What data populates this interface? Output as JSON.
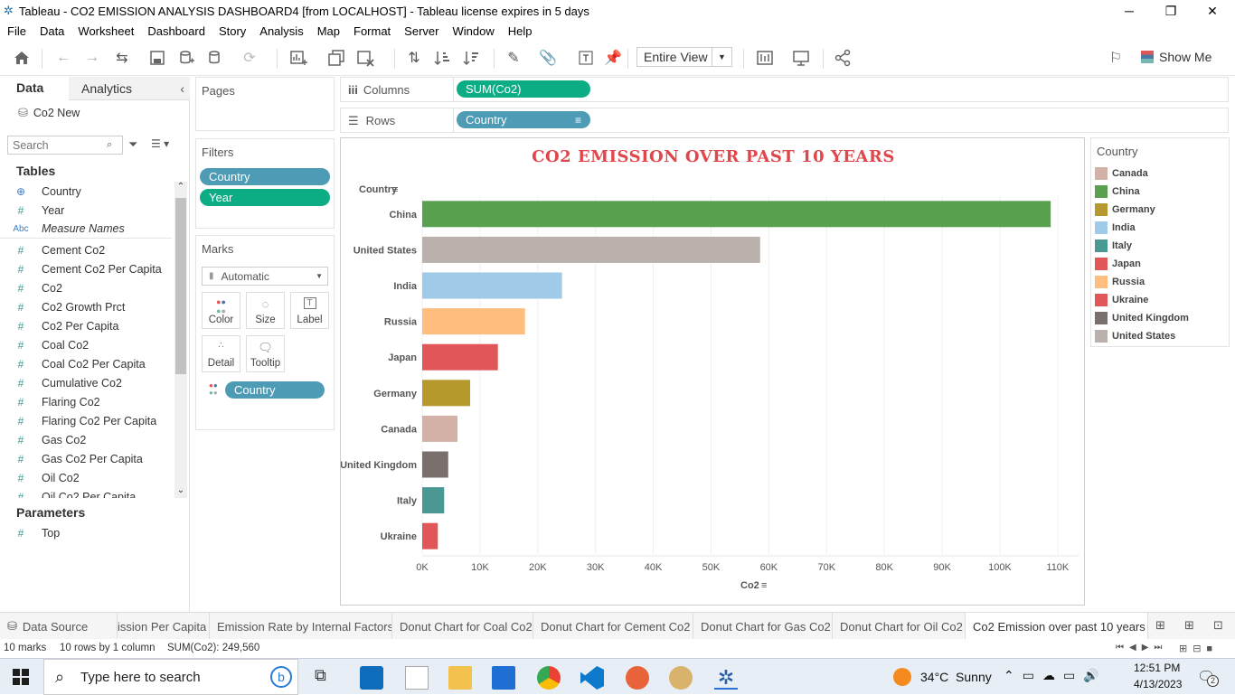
{
  "window": {
    "title": "Tableau - CO2 EMISSION ANALYSIS DASHBOARD4 [from LOCALHOST] - Tableau license expires in 5 days"
  },
  "menu": [
    "File",
    "Data",
    "Worksheet",
    "Dashboard",
    "Story",
    "Analysis",
    "Map",
    "Format",
    "Server",
    "Window",
    "Help"
  ],
  "toolbar": {
    "fit_mode": "Entire View",
    "show_me": "Show Me"
  },
  "data_pane": {
    "tab_data": "Data",
    "tab_analytics": "Analytics",
    "datasource": "Co2 New",
    "search_placeholder": "Search",
    "tables_header": "Tables",
    "fields": [
      {
        "icon": "globe",
        "name": "Country"
      },
      {
        "icon": "#",
        "name": "Year"
      },
      {
        "icon": "Abc",
        "name": "Measure Names"
      },
      {
        "icon": "#",
        "name": "Cement Co2"
      },
      {
        "icon": "#",
        "name": "Cement Co2 Per Capita"
      },
      {
        "icon": "#",
        "name": "Co2"
      },
      {
        "icon": "#",
        "name": "Co2 Growth Prct"
      },
      {
        "icon": "#",
        "name": "Co2 Per Capita"
      },
      {
        "icon": "#",
        "name": "Coal Co2"
      },
      {
        "icon": "#",
        "name": "Coal Co2 Per Capita"
      },
      {
        "icon": "#",
        "name": "Cumulative Co2"
      },
      {
        "icon": "#",
        "name": "Flaring Co2"
      },
      {
        "icon": "#",
        "name": "Flaring Co2 Per Capita"
      },
      {
        "icon": "#",
        "name": "Gas Co2"
      },
      {
        "icon": "#",
        "name": "Gas Co2 Per Capita"
      },
      {
        "icon": "#",
        "name": "Oil Co2"
      },
      {
        "icon": "#",
        "name": "Oil Co2 Per Capita"
      }
    ],
    "parameters_header": "Parameters",
    "parameters": [
      {
        "icon": "#",
        "name": "Top"
      }
    ]
  },
  "shelves": {
    "pages": "Pages",
    "filters": "Filters",
    "filter_pills": [
      "Country",
      "Year"
    ],
    "marks": "Marks",
    "mark_type": "Automatic",
    "mark_buttons": [
      "Color",
      "Size",
      "Label",
      "Detail",
      "Tooltip"
    ],
    "color_pill": "Country",
    "columns_label": "Columns",
    "columns_pill": "SUM(Co2)",
    "rows_label": "Rows",
    "rows_pill": "Country"
  },
  "chart_data": {
    "type": "bar",
    "orientation": "horizontal",
    "title": "CO2 EMISSION OVER PAST 10 YEARS",
    "ylabel": "Country",
    "xlabel": "Co2",
    "categories": [
      "China",
      "United States",
      "India",
      "Russia",
      "Japan",
      "Germany",
      "Canada",
      "United Kingdom",
      "Italy",
      "Ukraine"
    ],
    "values": [
      108800,
      58500,
      24200,
      17800,
      13100,
      8300,
      6100,
      4500,
      3800,
      2700
    ],
    "colors": [
      "#59a14f",
      "#bab0ac",
      "#a0cbe8",
      "#ffbe7d",
      "#e15759",
      "#b6992d",
      "#d4b1a6",
      "#79706e",
      "#499894",
      "#e15759"
    ],
    "xlim": [
      0,
      113000
    ],
    "xticks": [
      "0K",
      "10K",
      "20K",
      "30K",
      "40K",
      "50K",
      "60K",
      "70K",
      "80K",
      "90K",
      "100K",
      "110K"
    ],
    "grid": true
  },
  "legend": {
    "title": "Country",
    "items": [
      {
        "name": "Canada",
        "color": "#d4b1a6"
      },
      {
        "name": "China",
        "color": "#59a14f"
      },
      {
        "name": "Germany",
        "color": "#b6992d"
      },
      {
        "name": "India",
        "color": "#a0cbe8"
      },
      {
        "name": "Italy",
        "color": "#499894"
      },
      {
        "name": "Japan",
        "color": "#e15759"
      },
      {
        "name": "Russia",
        "color": "#ffbe7d"
      },
      {
        "name": "Ukraine",
        "color": "#e15759"
      },
      {
        "name": "United Kingdom",
        "color": "#79706e"
      },
      {
        "name": "United States",
        "color": "#bab0ac"
      }
    ]
  },
  "sheet_tabs": {
    "data_source": "Data Source",
    "tabs": [
      "ission Per Capita",
      "Emission Rate by Internal Factors",
      "Donut Chart for Coal Co2",
      "Donut Chart for Cement Co2",
      "Donut Chart for Gas Co2",
      "Donut Chart for Oil Co2",
      "Co2 Emission over past 10 years"
    ],
    "active_tab": "Co2 Emission over past 10 years"
  },
  "status": {
    "marks": "10 marks",
    "rows": "10 rows by 1 column",
    "sum": "SUM(Co2): 249,560"
  },
  "taskbar": {
    "search_placeholder": "Type here to search",
    "weather": "34°C  Sunny",
    "time": "12:51 PM",
    "date": "4/13/2023",
    "notifications": "2"
  }
}
